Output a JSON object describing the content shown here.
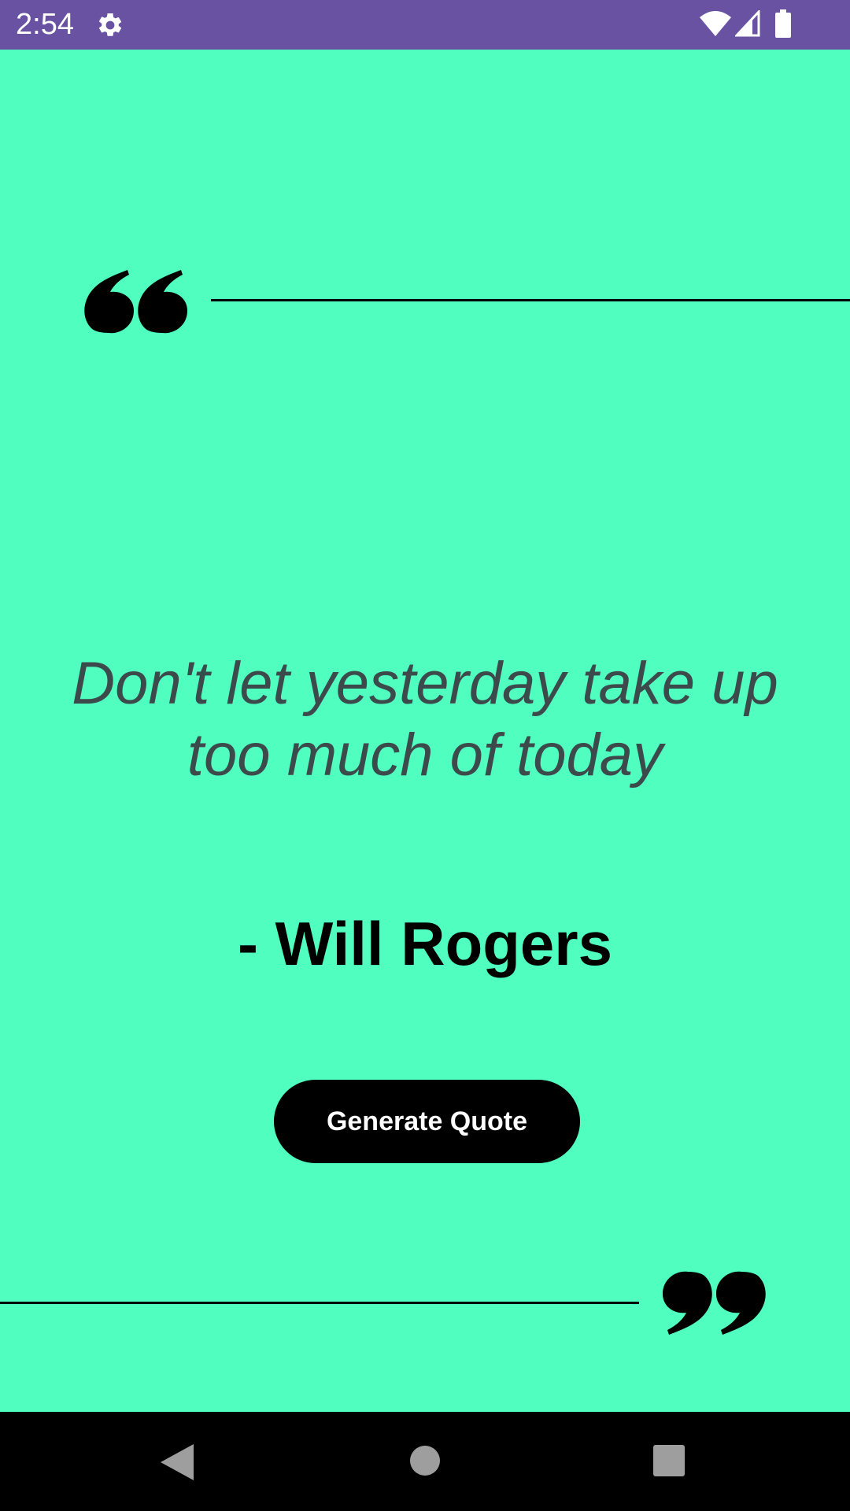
{
  "status_bar": {
    "time": "2:54",
    "background": "#6A52A3",
    "icons": [
      "gear-icon",
      "wifi-icon",
      "signal-icon",
      "battery-icon"
    ]
  },
  "main": {
    "background": "#50FFC0",
    "quote_text": "Don't let yesterday take up too much of today",
    "author": "- Will Rogers",
    "generate_button_label": "Generate Quote",
    "icons": [
      "open-quote-icon",
      "close-quote-icon"
    ]
  },
  "nav_bar": {
    "icons": [
      "back-icon",
      "home-icon",
      "recents-icon"
    ]
  }
}
